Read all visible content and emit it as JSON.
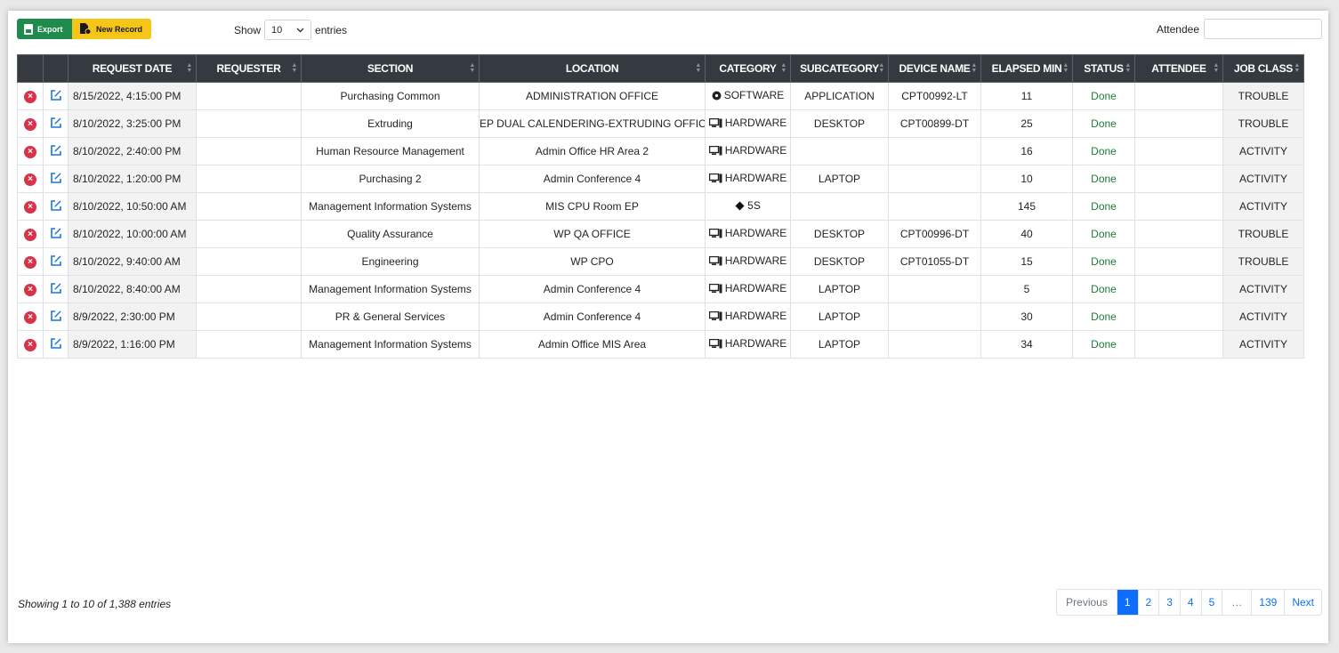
{
  "toolbar": {
    "export_label": "Export",
    "new_record_label": "New Record"
  },
  "length": {
    "show_label": "Show",
    "value": "10",
    "entries_label": "entries"
  },
  "search": {
    "label": "Attendee",
    "value": ""
  },
  "columns": [
    "REQUEST DATE",
    "REQUESTER",
    "SECTION",
    "LOCATION",
    "CATEGORY",
    "SUBCATEGORY",
    "DEVICE NAME",
    "ELAPSED MIN",
    "STATUS",
    "ATTENDEE",
    "JOB CLASS"
  ],
  "rows": [
    {
      "date": "8/15/2022, 4:15:00 PM",
      "requester": "",
      "section": "Purchasing Common",
      "location": "ADMINISTRATION OFFICE",
      "category": "SOFTWARE",
      "category_icon": "disc-icon",
      "subcategory": "APPLICATION",
      "device": "CPT00992-LT",
      "elapsed": "11",
      "status": "Done",
      "attendee": "",
      "job_class": "TROUBLE"
    },
    {
      "date": "8/10/2022, 3:25:00 PM",
      "requester": "",
      "section": "Extruding",
      "location": "EP DUAL CALENDERING-EXTRUDING OFFICE",
      "category": "HARDWARE",
      "category_icon": "desktop-icon",
      "subcategory": "DESKTOP",
      "device": "CPT00899-DT",
      "elapsed": "25",
      "status": "Done",
      "attendee": "",
      "job_class": "TROUBLE"
    },
    {
      "date": "8/10/2022, 2:40:00 PM",
      "requester": "",
      "section": "Human Resource Management",
      "location": "Admin Office HR Area 2",
      "category": "HARDWARE",
      "category_icon": "desktop-icon",
      "subcategory": "",
      "device": "",
      "elapsed": "16",
      "status": "Done",
      "attendee": "",
      "job_class": "ACTIVITY"
    },
    {
      "date": "8/10/2022, 1:20:00 PM",
      "requester": "",
      "section": "Purchasing 2",
      "location": "Admin Conference 4",
      "category": "HARDWARE",
      "category_icon": "desktop-icon",
      "subcategory": "LAPTOP",
      "device": "",
      "elapsed": "10",
      "status": "Done",
      "attendee": "",
      "job_class": "ACTIVITY"
    },
    {
      "date": "8/10/2022, 10:50:00 AM",
      "requester": "",
      "section": "Management Information Systems",
      "location": "MIS CPU Room EP",
      "category": "5S",
      "category_icon": "diamond-icon",
      "subcategory": "",
      "device": "",
      "elapsed": "145",
      "status": "Done",
      "attendee": "",
      "job_class": "ACTIVITY"
    },
    {
      "date": "8/10/2022, 10:00:00 AM",
      "requester": "",
      "section": "Quality Assurance",
      "location": "WP QA OFFICE",
      "category": "HARDWARE",
      "category_icon": "desktop-icon",
      "subcategory": "DESKTOP",
      "device": "CPT00996-DT",
      "elapsed": "40",
      "status": "Done",
      "attendee": "",
      "job_class": "TROUBLE"
    },
    {
      "date": "8/10/2022, 9:40:00 AM",
      "requester": "",
      "section": "Engineering",
      "location": "WP CPO",
      "category": "HARDWARE",
      "category_icon": "desktop-icon",
      "subcategory": "DESKTOP",
      "device": "CPT01055-DT",
      "elapsed": "15",
      "status": "Done",
      "attendee": "",
      "job_class": "TROUBLE"
    },
    {
      "date": "8/10/2022, 8:40:00 AM",
      "requester": "",
      "section": "Management Information Systems",
      "location": "Admin Conference 4",
      "category": "HARDWARE",
      "category_icon": "desktop-icon",
      "subcategory": "LAPTOP",
      "device": "",
      "elapsed": "5",
      "status": "Done",
      "attendee": "",
      "job_class": "ACTIVITY"
    },
    {
      "date": "8/9/2022, 2:30:00 PM",
      "requester": "",
      "section": "PR & General Services",
      "location": "Admin Conference 4",
      "category": "HARDWARE",
      "category_icon": "desktop-icon",
      "subcategory": "LAPTOP",
      "device": "",
      "elapsed": "30",
      "status": "Done",
      "attendee": "",
      "job_class": "ACTIVITY"
    },
    {
      "date": "8/9/2022, 1:16:00 PM",
      "requester": "",
      "section": "Management Information Systems",
      "location": "Admin Office MIS Area",
      "category": "HARDWARE",
      "category_icon": "desktop-icon",
      "subcategory": "LAPTOP",
      "device": "",
      "elapsed": "34",
      "status": "Done",
      "attendee": "",
      "job_class": "ACTIVITY"
    }
  ],
  "info": "Showing 1 to 10 of 1,388 entries",
  "pagination": {
    "previous": "Previous",
    "pages": [
      "1",
      "2",
      "3",
      "4",
      "5",
      "…",
      "139"
    ],
    "active": "1",
    "next": "Next"
  },
  "colors": {
    "export": "#1e8a4c",
    "new_record": "#f5c518",
    "header": "#343a40",
    "status_done": "#1e7b3a",
    "delete": "#d9334a",
    "edit": "#1a73e8",
    "active_page": "#0d6efd"
  }
}
